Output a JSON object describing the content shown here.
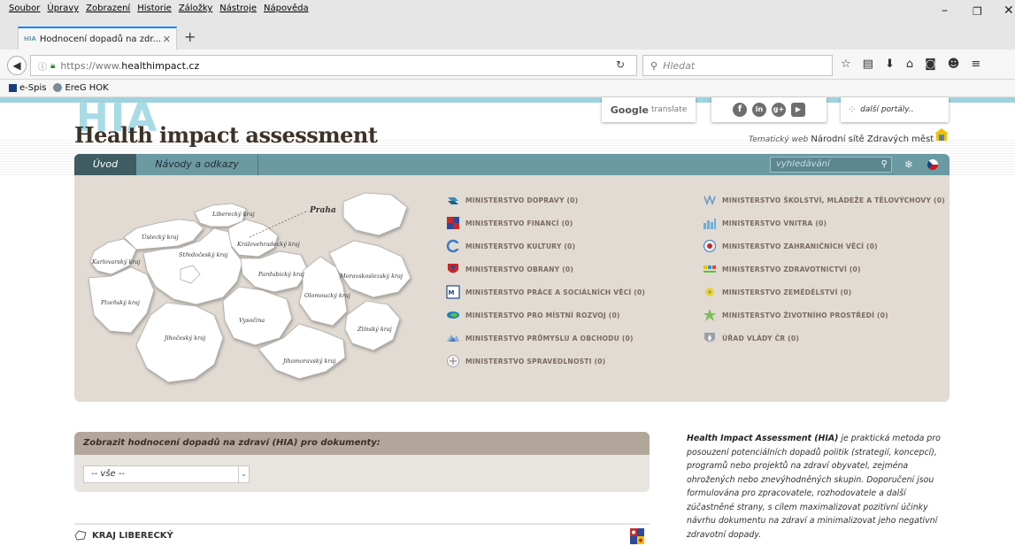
{
  "browser": {
    "menu": [
      "Soubor",
      "Úpravy",
      "Zobrazení",
      "Historie",
      "Záložky",
      "Nástroje",
      "Nápověda"
    ],
    "tab_title": "Hodnocení dopadů na zdr...",
    "tab_favicon_text": "HIA",
    "url_protocol": "https://www.",
    "url_host": "healthimpact.cz",
    "search_placeholder": "Hledat",
    "bookmarks": [
      "e-Spis",
      "EreG HOK"
    ]
  },
  "header": {
    "hia_logo": "HIA",
    "title": "Health impact assessment",
    "google_brand": "Google",
    "google_translate": "translate",
    "other_portals": "další portály..",
    "tematic_prefix": "Tematický web",
    "tematic_name": "Národní sítě Zdravých měst"
  },
  "nav": {
    "items": [
      "Úvod",
      "Návody a odkazy"
    ],
    "search_placeholder": "vyhledávání"
  },
  "map": {
    "labels": {
      "praha": "Praha",
      "liberecky": "Liberecký kraj",
      "ustecky": "Ústecký kraj",
      "karlovarsky": "Karlovarský kraj",
      "stredocesky": "Středočeský kraj",
      "kralovehradecky": "Královehradecký kraj",
      "pardubicky": "Pardubický kraj",
      "plzensky": "Plzeňský kraj",
      "jihocesky": "Jihočeský kraj",
      "vysocina": "Vysočina",
      "jihomoravsky": "Jihomoravský kraj",
      "olomoucky": "Olomoucký kraj",
      "moravskoslezsky": "Moravskoslezský kraj",
      "zlinsky": "Zlínský kraj"
    }
  },
  "ministries_left": [
    "MINISTERSTVO DOPRAVY (0)",
    "MINISTERSTVO FINANCÍ (0)",
    "MINISTERSTVO KULTURY (0)",
    "MINISTERSTVO OBRANY (0)",
    "MINISTERSTVO PRÁCE A SOCIÁLNÍCH VĚCÍ (0)",
    "MINISTERSTVO PRO MÍSTNÍ ROZVOJ (0)",
    "MINISTERSTVO PRŮMYSLU A OBCHODU (0)",
    "MINISTERSTVO SPRAVEDLNOSTI (0)"
  ],
  "ministries_right": [
    "MINISTERSTVO ŠKOLSTVÍ, MLÁDEŽE A TĚLOVÝCHOVY (0)",
    "MINISTERSTVO VNITRA (0)",
    "MINISTERSTVO ZAHRANIČNÍCH VĚCÍ (0)",
    "MINISTERSTVO ZDRAVOTNICTVÍ (0)",
    "MINISTERSTVO ZEMĚDĚLSTVÍ (0)",
    "MINISTERSTVO ŽIVOTNÍHO PROSTŘEDÍ (0)",
    "ÚŘAD VLÁDY ČR (0)"
  ],
  "documents": {
    "heading": "Zobrazit hodnocení dopadů na zdraví (HIA) pro dokumenty:",
    "selected": "-- vše --"
  },
  "sidebar": {
    "lead": "Health Impact Assessment (HIA)",
    "text": " je praktická metoda pro posouzení potenciálních dopadů politik (strategií, koncepcí), programů nebo projektů na zdraví obyvatel, zejména ohrožených nebo znevýhodněných skupin. Doporučení jsou formulována pro zpracovatele, rozhodovatele a další zúčastněné strany, s cílem maximalizovat pozitivní účinky návrhu dokumentu na zdraví a minimalizovat jeho negativní zdravotní dopady."
  },
  "kraj": {
    "name": "KRAJ LIBERECKÝ"
  },
  "colors": {
    "nav_bg": "#6b9aa3",
    "nav_active": "#3f5c62",
    "panel_bg": "#e1dbd3",
    "title": "#3e3228",
    "ministry_text": "#7a6a66"
  }
}
